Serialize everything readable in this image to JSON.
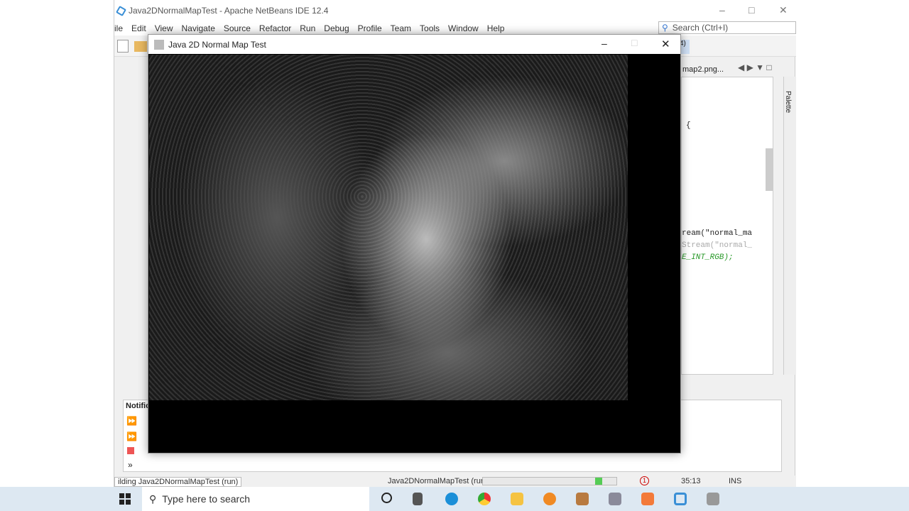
{
  "ide": {
    "title": "Java2DNormalMapTest - Apache NetBeans IDE 12.4",
    "menu": [
      "ile",
      "Edit",
      "View",
      "Navigate",
      "Source",
      "Refactor",
      "Run",
      "Debug",
      "Profile",
      "Team",
      "Tools",
      "Window",
      "Help"
    ],
    "search_placeholder": "Search (Ctrl+I)",
    "tab_partial": "4)",
    "editor_tab": "map2.png...",
    "palette": "Palette",
    "code": [
      "{",
      "ream(\"normal_ma",
      "Stream(\"normal_",
      "E_INT_RGB);"
    ],
    "notifications": "Notific",
    "status": {
      "left": "ilding Java2DNormalMapTest (run)",
      "task": "Java2DNormalMapTest (run)",
      "position": "35:13",
      "mode": "INS",
      "errors": "1"
    }
  },
  "app": {
    "title": "Java 2D Normal Map Test"
  },
  "taskbar": {
    "search_placeholder": "Type here to search"
  }
}
